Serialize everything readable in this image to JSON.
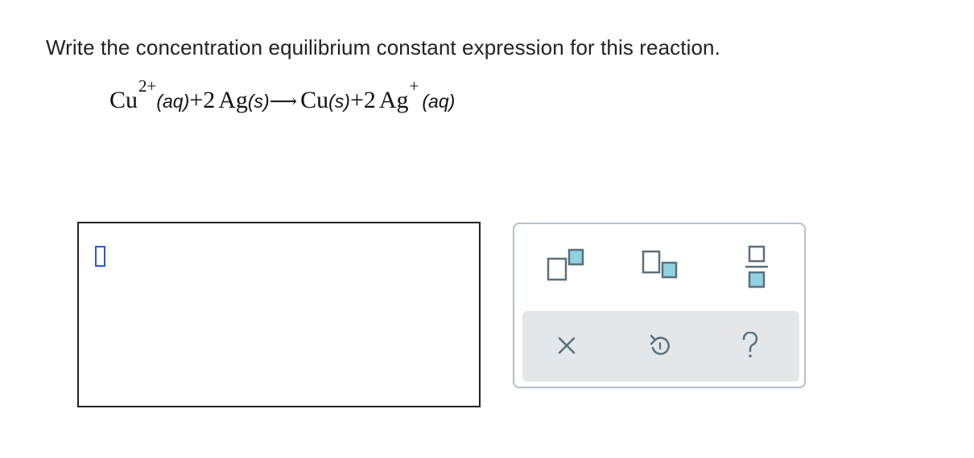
{
  "question": {
    "text": "Write the concentration equilibrium constant expression for this reaction."
  },
  "equation": {
    "cu_ion": "Cu",
    "cu_ion_charge": "2+",
    "phase_aq_1": "(aq)",
    "plus_1": "+",
    "coef_ag": "2",
    "ag": "Ag",
    "phase_s_1": "(s)",
    "arrow": "⟶",
    "cu_metal": "Cu",
    "phase_s_2": "(s)",
    "plus_2": "+",
    "coef_ag_ion": "2",
    "ag_ion": "Ag",
    "ag_ion_charge": "+",
    "phase_aq_2": "(aq)"
  },
  "palette": {
    "tools": [
      {
        "name": "superscript-template-icon"
      },
      {
        "name": "subscript-template-icon"
      },
      {
        "name": "fraction-template-icon"
      }
    ],
    "actions": [
      {
        "name": "clear-icon",
        "glyph": "×"
      },
      {
        "name": "undo-icon",
        "glyph": "↺"
      },
      {
        "name": "help-icon",
        "glyph": "?"
      }
    ]
  },
  "colors": {
    "cursor_blue": "#3355cc",
    "template_teal": "#8fd3e0",
    "template_outline": "#5a6f7c",
    "action_bar_bg": "#e3e7ea",
    "palette_border": "#b9c2c9"
  }
}
